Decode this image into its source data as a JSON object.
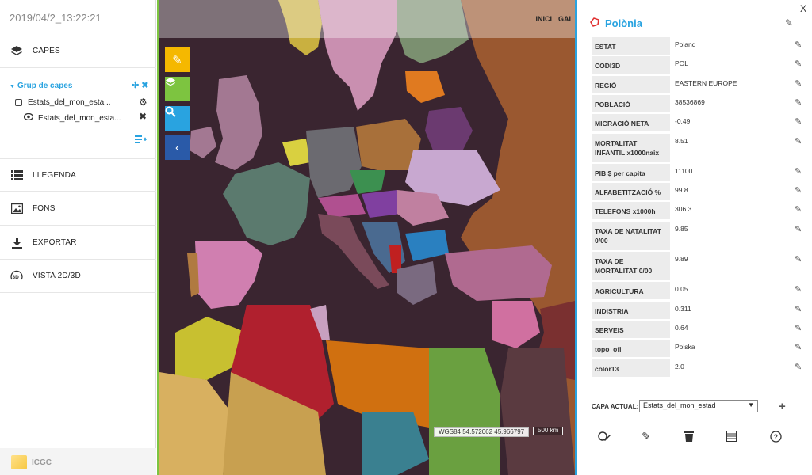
{
  "left": {
    "datetime": "2019/04/2_13:22:21",
    "menu_capes": "CAPES",
    "group_title": "Grup de capes",
    "group_tools": "✢ ✖",
    "layer_1": "Estats_del_mon_esta...",
    "layer_2": "Estats_del_mon_esta...",
    "menu_llegenda": "LLEGENDA",
    "menu_fons": "FONS",
    "menu_exportar": "EXPORTAR",
    "menu_vista": "VISTA 2D/3D",
    "logo": "ICGC"
  },
  "map": {
    "nav_inici": "INICI",
    "nav_gal": "GAL",
    "coords": "WGS84 54.572062 45.966797",
    "scale": "500 km",
    "colors": {
      "sea": "#3a2530",
      "land_default": "#c9885a",
      "edit_tool": "#f5b800",
      "layers_tool": "#7dc440",
      "search_tool": "#29a3e0",
      "collapse_tool": "#2a5aa8"
    }
  },
  "right": {
    "close": "X",
    "title": "Polònia",
    "attributes": [
      {
        "name": "ESTAT",
        "value": "Poland"
      },
      {
        "name": "CODI3D",
        "value": "POL"
      },
      {
        "name": "REGIÓ",
        "value": "EASTERN EUROPE"
      },
      {
        "name": "POBLACIÓ",
        "value": "38536869"
      },
      {
        "name": "MIGRACIÓ NETA",
        "value": "-0.49"
      },
      {
        "name": "MORTALITAT INFANTIL x1000naix",
        "value": "8.51"
      },
      {
        "name": "PIB $ per capita",
        "value": "11100"
      },
      {
        "name": "ALFABETITZACIÓ %",
        "value": "99.8"
      },
      {
        "name": "TELEFONS x1000h",
        "value": "306.3"
      },
      {
        "name": "TAXA DE NATALITAT 0/00",
        "value": "9.85"
      },
      {
        "name": "TAXA DE MORTALITAT 0/00",
        "value": "9.89"
      },
      {
        "name": "AGRICULTURA",
        "value": "0.05"
      },
      {
        "name": "INDISTRIA",
        "value": "0.311"
      },
      {
        "name": "SERVEIS",
        "value": "0.64"
      },
      {
        "name": "topo_ofi",
        "value": "Polska"
      },
      {
        "name": "color13",
        "value": "2.0"
      }
    ],
    "capa_label": "CAPA ACTUAL:",
    "capa_value": "Estats_del_mon_estad",
    "accent": "#29a3e0"
  }
}
